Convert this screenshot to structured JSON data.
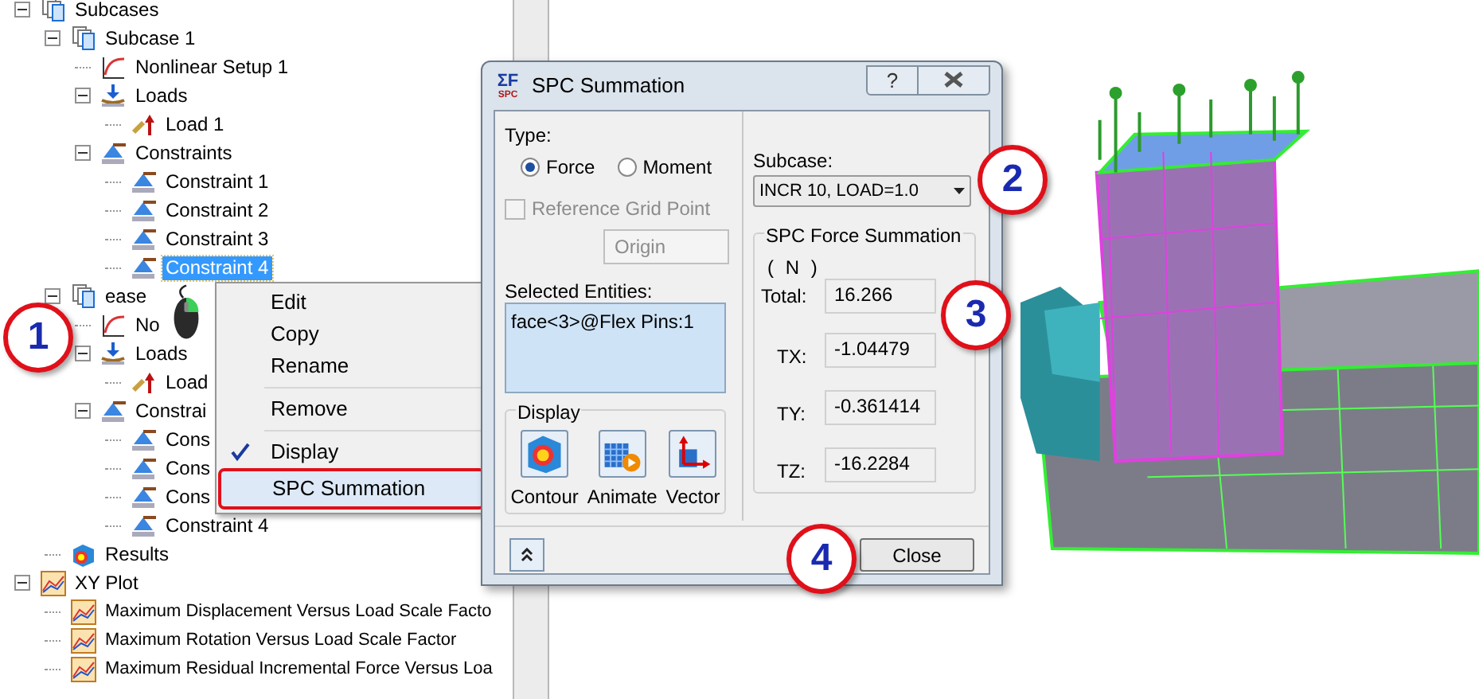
{
  "tree": [
    {
      "label": "Subcases",
      "kind": "subcases",
      "expanded": true,
      "selected": false,
      "children": [
        {
          "label": "Subcase 1",
          "kind": "subcase",
          "expanded": true,
          "selected": false,
          "children": [
            {
              "label": "Nonlinear Setup 1",
              "kind": "setup",
              "selected": false
            },
            {
              "label": "Loads",
              "kind": "loads",
              "expanded": true,
              "selected": false,
              "children": [
                {
                  "label": "Load 1",
                  "kind": "load",
                  "selected": false
                }
              ]
            },
            {
              "label": "Constraints",
              "kind": "constraints",
              "expanded": true,
              "selected": false,
              "children": [
                {
                  "label": "Constraint 1",
                  "kind": "constraint",
                  "selected": false
                },
                {
                  "label": "Constraint 2",
                  "kind": "constraint",
                  "selected": false
                },
                {
                  "label": "Constraint 3",
                  "kind": "constraint",
                  "selected": false
                },
                {
                  "label": "Constraint 4",
                  "kind": "constraint",
                  "selected": true
                }
              ]
            }
          ]
        },
        {
          "label": "ease",
          "kind": "subcase",
          "expanded": true,
          "selected": false,
          "children": [
            {
              "label": "No",
              "kind": "setup",
              "selected": false
            },
            {
              "label": "Loads",
              "kind": "loads",
              "expanded": true,
              "selected": false,
              "children": [
                {
                  "label": "Load",
                  "kind": "load",
                  "selected": false
                }
              ]
            },
            {
              "label": "Constrai",
              "kind": "constraints",
              "expanded": true,
              "selected": false,
              "children": [
                {
                  "label": "Cons",
                  "kind": "constraint",
                  "selected": false
                },
                {
                  "label": "Cons",
                  "kind": "constraint",
                  "selected": false
                },
                {
                  "label": "Cons",
                  "kind": "constraint",
                  "selected": false
                },
                {
                  "label": "Constraint 4",
                  "kind": "constraint",
                  "selected": false
                }
              ]
            }
          ]
        },
        {
          "label": "Results",
          "kind": "results",
          "selected": false
        }
      ]
    },
    {
      "label": "XY Plot",
      "kind": "xyplot",
      "expanded": true,
      "selected": false,
      "children": [
        {
          "label": "Maximum Displacement Versus Load Scale Facto",
          "kind": "plot",
          "selected": false
        },
        {
          "label": "Maximum Rotation Versus Load Scale Factor",
          "kind": "plot",
          "selected": false
        },
        {
          "label": "Maximum Residual Incremental Force Versus Loa",
          "kind": "plot",
          "selected": false
        }
      ]
    }
  ],
  "context_menu": [
    {
      "kind": "item",
      "label": "Edit",
      "checked": false,
      "selected": false
    },
    {
      "kind": "item",
      "label": "Copy",
      "checked": false,
      "selected": false
    },
    {
      "kind": "item",
      "label": "Rename",
      "checked": false,
      "selected": false
    },
    {
      "kind": "separator"
    },
    {
      "kind": "item",
      "label": "Remove",
      "checked": false,
      "selected": false
    },
    {
      "kind": "separator"
    },
    {
      "kind": "item",
      "label": "Display",
      "checked": true,
      "selected": false
    },
    {
      "kind": "item",
      "label": "SPC Summation",
      "checked": false,
      "selected": true
    }
  ],
  "dialog": {
    "logo_top": "ΣF",
    "logo_bottom": "SPC",
    "title": "SPC Summation",
    "help_button": "?",
    "type": {
      "label": "Type:",
      "options": [
        {
          "label": "Force",
          "selected": true
        },
        {
          "label": "Moment",
          "selected": false
        }
      ]
    },
    "reference_grid_point": {
      "label": "Reference Grid Point",
      "checked": false,
      "disabled": true
    },
    "origin_button": {
      "label": "Origin",
      "disabled": true
    },
    "selected_entities": {
      "label": "Selected Entities:",
      "items": [
        "face<3>@Flex Pins:1"
      ]
    },
    "display": {
      "label": "Display",
      "buttons": [
        {
          "label": "Contour",
          "kind": "contour"
        },
        {
          "label": "Animate",
          "kind": "animate"
        },
        {
          "label": "Vector",
          "kind": "vector"
        }
      ]
    },
    "subcase": {
      "label": "Subcase:",
      "value": "INCR 10, LOAD=1.0"
    },
    "summation": {
      "title": "SPC Force Summation",
      "unit": "( N )",
      "fields": [
        {
          "label": "Total:",
          "value": "16.266"
        },
        {
          "label": "TX:",
          "value": "-1.04479"
        },
        {
          "label": "TY:",
          "value": "-0.361414"
        },
        {
          "label": "TZ:",
          "value": "-16.2284"
        }
      ]
    },
    "close_button": "Close"
  },
  "callouts": [
    "1",
    "2",
    "3",
    "4"
  ]
}
